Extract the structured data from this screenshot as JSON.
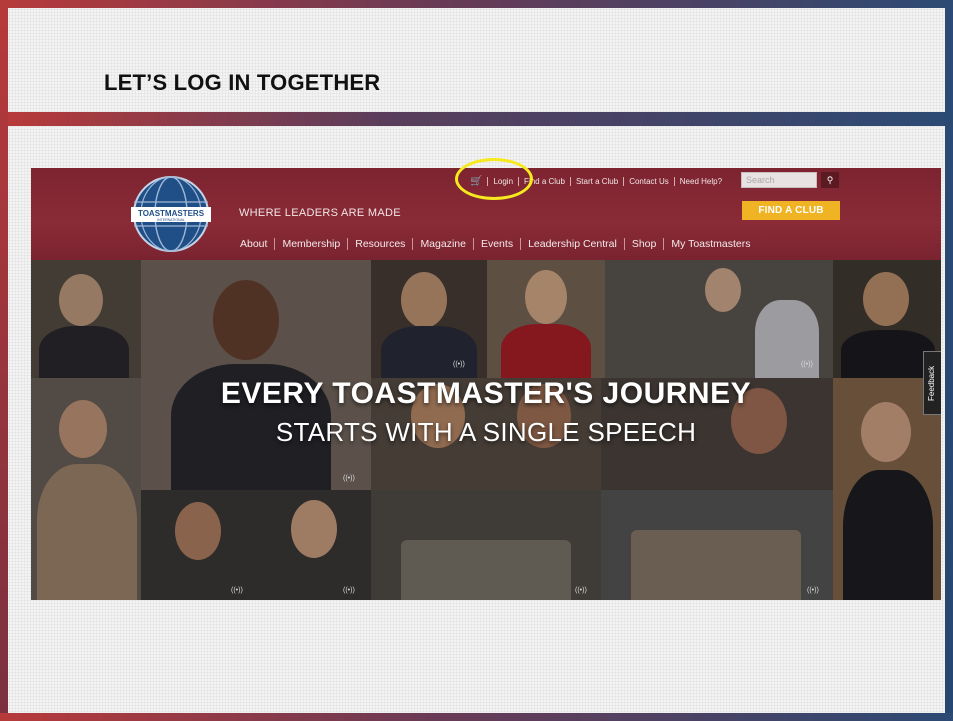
{
  "slide": {
    "title": "LET’S LOG IN TOGETHER"
  },
  "site": {
    "logo_text": "TOASTMASTERS",
    "logo_subtext": "INTERNATIONAL",
    "tagline": "WHERE LEADERS ARE MADE",
    "utility_links": [
      "Login",
      "Find a Club",
      "Start a Club",
      "Contact Us",
      "Need Help?"
    ],
    "search_placeholder": "Search",
    "find_club_button": "FIND A CLUB",
    "nav": [
      "About",
      "Membership",
      "Resources",
      "Magazine",
      "Events",
      "Leadership Central",
      "Shop",
      "My Toastmasters"
    ],
    "hero_line1": "EVERY TOASTMASTER'S JOURNEY",
    "hero_line2": "STARTS WITH A SINGLE SPEECH",
    "feedback_tab": "Feedback",
    "radio_badge": "((•))"
  },
  "colors": {
    "header_bg": "#8a2b37",
    "find_club_bg": "#f0b323",
    "highlight": "#f6ea1e"
  }
}
